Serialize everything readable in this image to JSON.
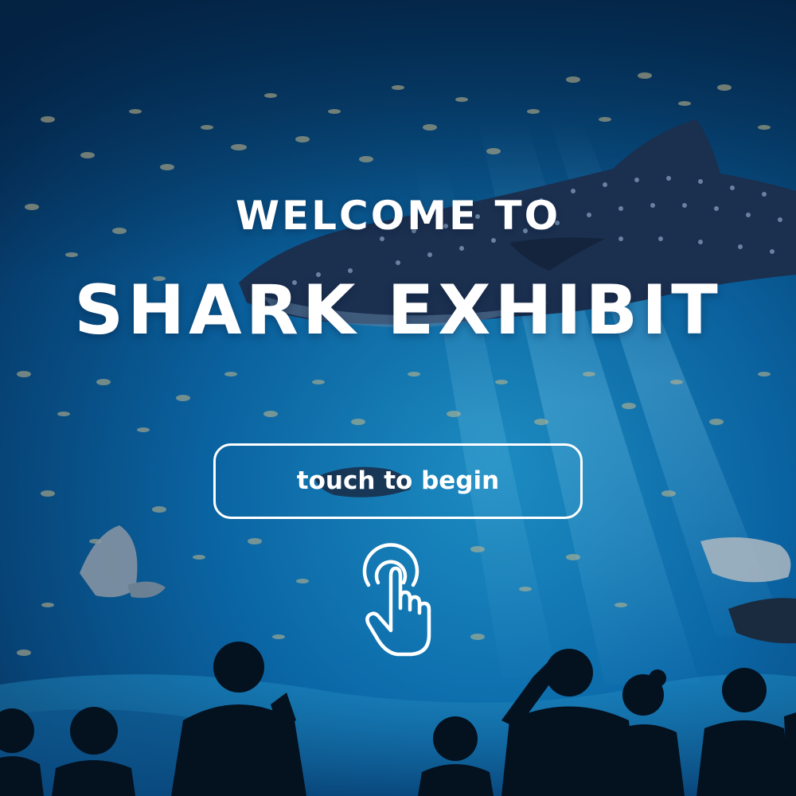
{
  "welcome": {
    "heading": "WELCOME TO",
    "title": "SHARK EXHIBIT"
  },
  "start": {
    "button_label": "touch to begin"
  },
  "icons": {
    "tap": "tap-hand-icon"
  },
  "colors": {
    "text": "#ffffff",
    "water_light": "#1f97cf",
    "water_mid": "#0b5e9e",
    "water_dark": "#062a52",
    "shark": "#1b2f4f",
    "silhouette": "#04111f"
  }
}
